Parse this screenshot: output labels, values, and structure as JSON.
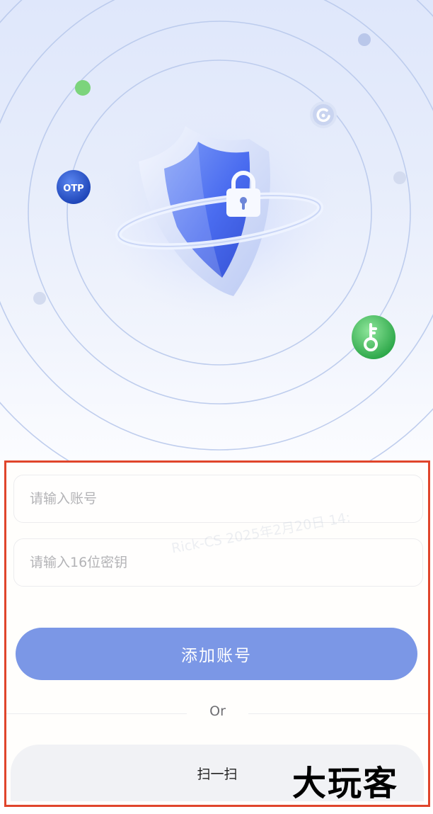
{
  "hero": {
    "badges": {
      "otp_label": "OTP"
    },
    "icons": {
      "shield": "shield-lock-icon",
      "otp": "otp-badge-icon",
      "refresh": "refresh-icon",
      "key": "key-icon"
    },
    "colors": {
      "otp_badge": "#2f62d9",
      "key_badge": "#3fbf5a",
      "green_dot": "#7cd47c",
      "shield_blue": "#4a6cf0"
    }
  },
  "form": {
    "account_placeholder": "请输入账号",
    "secret_placeholder": "请输入16位密钥",
    "add_button_label": "添加账号",
    "or_label": "Or",
    "scan_button_label": "扫一扫"
  },
  "watermarks": {
    "faint_text": "Rick-CS 2025年2月20日 14:",
    "corner_logo": "大玩客"
  },
  "colors": {
    "accent": "#7b97e6",
    "highlight_border": "#e0452b"
  }
}
